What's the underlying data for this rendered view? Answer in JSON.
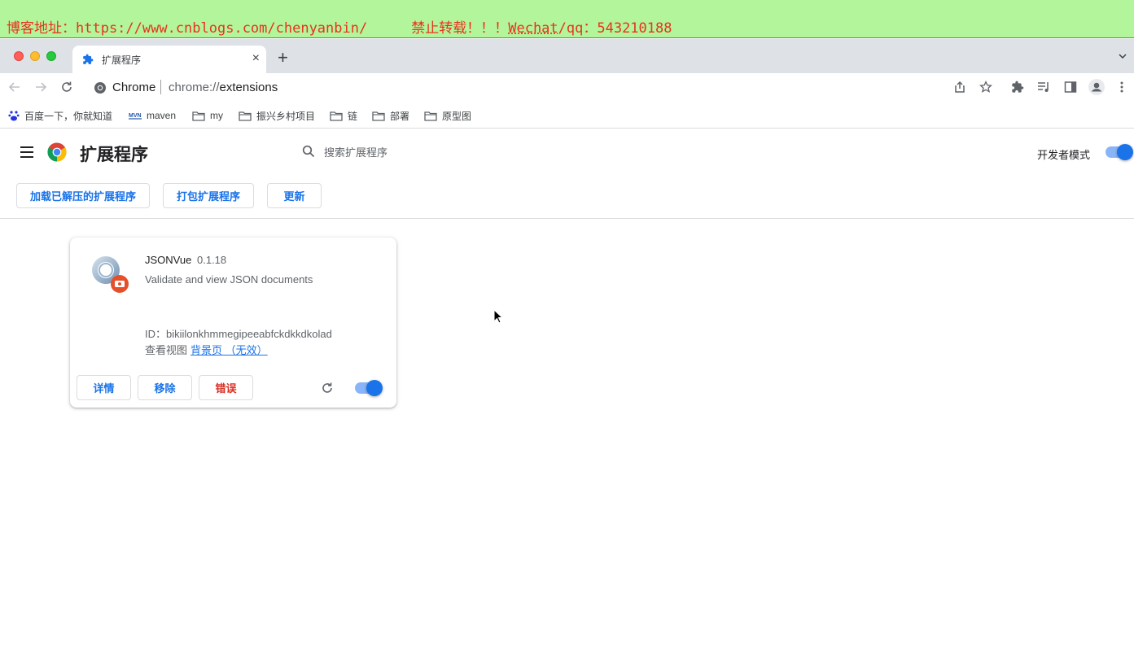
{
  "watermark": {
    "blog": "博客地址：https://www.cnblogs.com/chenyanbin/",
    "notice": "禁止转载！！！",
    "contact_prefix": "Wechat",
    "contact_rest": "/qq：543210188"
  },
  "tab": {
    "title": "扩展程序",
    "close": "×",
    "new_tab": "+"
  },
  "omnibox": {
    "site": "Chrome",
    "url_scheme": "chrome://",
    "url_path": "extensions"
  },
  "bookmarks": [
    {
      "label": "百度一下，你就知道",
      "icon": "baidu-icon"
    },
    {
      "label": "maven",
      "icon": "maven-icon"
    },
    {
      "label": "my",
      "icon": "folder-icon"
    },
    {
      "label": "振兴乡村项目",
      "icon": "folder-icon"
    },
    {
      "label": "链",
      "icon": "folder-icon"
    },
    {
      "label": "部署",
      "icon": "folder-icon"
    },
    {
      "label": "原型图",
      "icon": "folder-icon"
    }
  ],
  "header": {
    "title": "扩展程序",
    "search_placeholder": "搜索扩展程序",
    "dev_mode_label": "开发者模式",
    "dev_mode_on": true
  },
  "actions": {
    "load_unpacked": "加载已解压的扩展程序",
    "pack": "打包扩展程序",
    "update": "更新"
  },
  "extension": {
    "name": "JSONVue",
    "version": "0.1.18",
    "description": "Validate and view JSON documents",
    "id_label": "ID：",
    "id": "bikiilonkhmmegipeeabfckdkkdkolad",
    "views_label": "查看视图",
    "views_link": "背景页 （无效）",
    "details": "详情",
    "remove": "移除",
    "errors": "错误",
    "enabled": true
  },
  "colors": {
    "accent": "#1a73e8",
    "error": "#d93025",
    "banner": "#b3f59a",
    "watermark_text": "#e8321e"
  }
}
